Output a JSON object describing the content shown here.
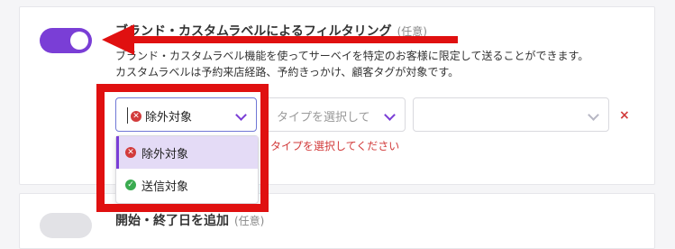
{
  "section": {
    "title": "ブランド・カスタムラベルによるフィルタリング",
    "optional_tag": "(任意)",
    "desc_line1": "ブランド・カスタムラベル機能を使ってサーベイを特定のお客様に限定して送ることができます。",
    "desc_line2": "カスタムラベルは予約来店経路、予約きっかけ、顧客タグが対象です。",
    "toggle_on": true
  },
  "filters": {
    "first_value": "除外対象",
    "type_placeholder": "タイプを選択して",
    "third_placeholder": "",
    "remove_icon": "×",
    "error_text": "タイプを選択してください"
  },
  "dropdown": {
    "options": [
      {
        "label": "除外対象",
        "icon": "x-circle-icon",
        "selected": true
      },
      {
        "label": "送信対象",
        "icon": "check-circle-icon",
        "selected": false
      }
    ]
  },
  "next_section": {
    "title": "開始・終了日を追加",
    "optional_tag": "(任意)"
  },
  "colors": {
    "accent": "#7a3ed6",
    "annotation_red": "#e01010",
    "error_red": "#d23b3b",
    "success_green": "#3aab50"
  }
}
